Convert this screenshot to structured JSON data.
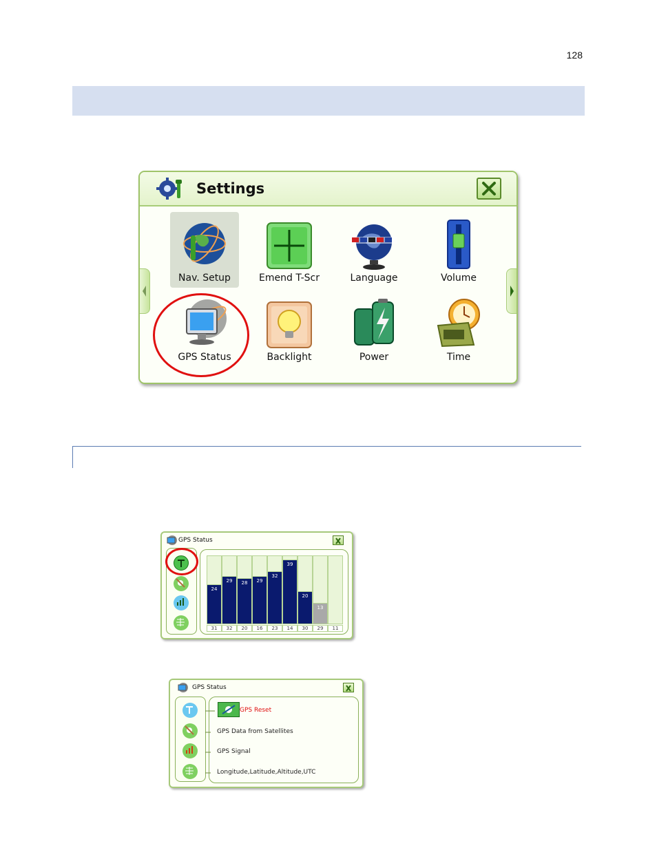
{
  "page": {
    "number": "128"
  },
  "settings": {
    "title": "Settings",
    "items": [
      {
        "label": "Nav. Setup",
        "icon": "globe-wrench-icon"
      },
      {
        "label": "Emend T-Scr",
        "icon": "crosshair-icon"
      },
      {
        "label": "Language",
        "icon": "globe-flags-icon"
      },
      {
        "label": "Volume",
        "icon": "volume-slider-icon"
      },
      {
        "label": "GPS Status",
        "icon": "monitor-satellite-icon"
      },
      {
        "label": "Backlight",
        "icon": "lightbulb-icon"
      },
      {
        "label": "Power",
        "icon": "battery-icon"
      },
      {
        "label": "Time",
        "icon": "clock-calendar-icon"
      }
    ]
  },
  "gps_signal": {
    "title": "GPS Status",
    "satellites": [
      {
        "id": "31",
        "signal": 24,
        "active": true
      },
      {
        "id": "32",
        "signal": 29,
        "active": true
      },
      {
        "id": "20",
        "signal": 28,
        "active": true
      },
      {
        "id": "16",
        "signal": 29,
        "active": true
      },
      {
        "id": "23",
        "signal": 32,
        "active": true
      },
      {
        "id": "14",
        "signal": 39,
        "active": true
      },
      {
        "id": "30",
        "signal": 20,
        "active": true
      },
      {
        "id": "29",
        "signal": 13,
        "active": false
      },
      {
        "id": "11",
        "signal": 0,
        "active": false
      }
    ]
  },
  "gps_menu": {
    "title": "GPS Status",
    "options": [
      {
        "label": "GPS Reset",
        "color": "#e01010"
      },
      {
        "label": "GPS Data from Satellites"
      },
      {
        "label": "GPS Signal"
      },
      {
        "label": "Longitude,Latitude,Altitude,UTC"
      }
    ]
  },
  "colors": {
    "accent_green": "#9fc46a",
    "highlight_red": "#e01010",
    "bar_blue": "#0a1a6e",
    "bar_gray": "#a9a9a9"
  }
}
